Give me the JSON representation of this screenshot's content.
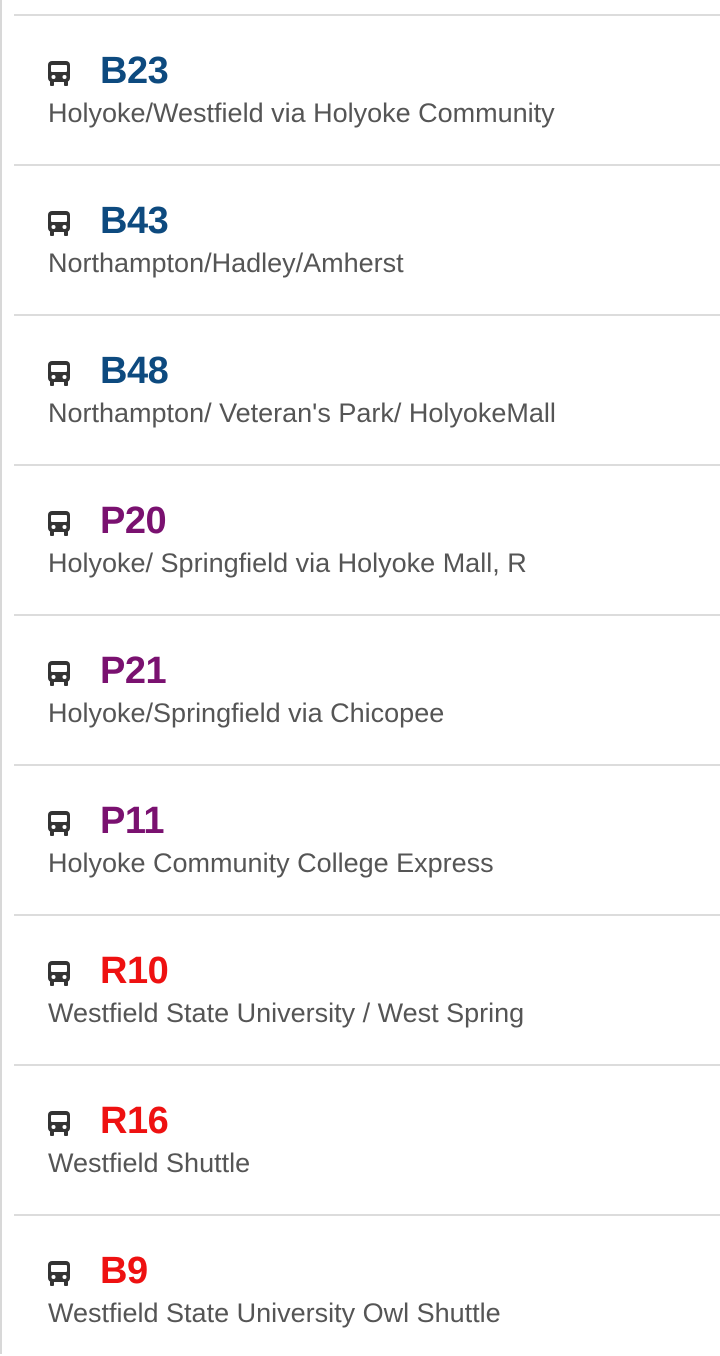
{
  "routes": [
    {
      "code": "B23",
      "name": "Holyoke/Westfield via Holyoke Community",
      "color": "#0d4a7f",
      "icon": "bus-icon"
    },
    {
      "code": "B43",
      "name": "Northampton/Hadley/Amherst",
      "color": "#0d4a7f",
      "icon": "bus-icon"
    },
    {
      "code": "B48",
      "name": "Northampton/ Veteran's Park/ HolyokeMall",
      "color": "#0d4a7f",
      "icon": "bus-icon"
    },
    {
      "code": "P20",
      "name": "Holyoke/ Springfield via Holyoke Mall, R",
      "color": "#7a1170",
      "icon": "bus-icon"
    },
    {
      "code": "P21",
      "name": "Holyoke/Springfield via Chicopee",
      "color": "#7a1170",
      "icon": "bus-icon"
    },
    {
      "code": "P11",
      "name": "Holyoke Community College Express",
      "color": "#7a1170",
      "icon": "bus-icon"
    },
    {
      "code": "R10",
      "name": "Westfield State University / West Spring",
      "color": "#ee1111",
      "icon": "bus-icon"
    },
    {
      "code": "R16",
      "name": "Westfield Shuttle",
      "color": "#ee1111",
      "icon": "bus-icon"
    },
    {
      "code": "B9",
      "name": "Westfield State University Owl Shuttle",
      "color": "#ee1111",
      "icon": "bus-icon"
    }
  ]
}
